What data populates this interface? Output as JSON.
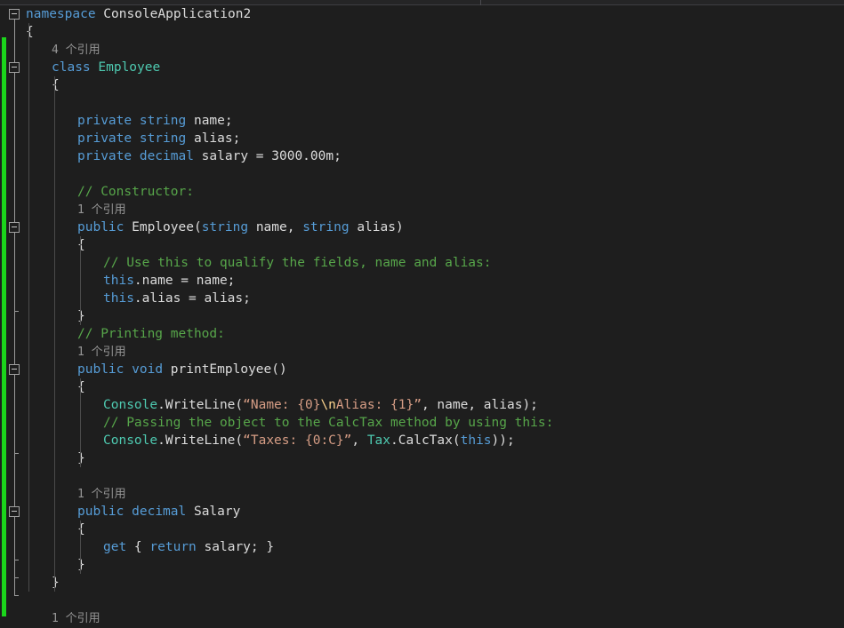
{
  "window": {
    "theme": "visual-studio-dark",
    "colors": {
      "background": "#1E1E1E",
      "chrome": "#252526",
      "keyword": "#569CD6",
      "type": "#4EC9B0",
      "string": "#D69D85",
      "comment": "#57A64A",
      "foreground": "#DCDCDC",
      "codelens": "#969696",
      "change_bar_saved": "#1BD51B",
      "indent_guide": "#4B4B4B",
      "fold_marker": "#A0A0A0"
    }
  },
  "editor": {
    "language": "csharp",
    "fold_markers": [
      {
        "name": "fold-namespace",
        "state": "expanded"
      },
      {
        "name": "fold-class-employee",
        "state": "expanded"
      },
      {
        "name": "fold-constructor-employee",
        "state": "expanded"
      },
      {
        "name": "fold-method-printemployee",
        "state": "expanded"
      },
      {
        "name": "fold-property-salary",
        "state": "expanded"
      }
    ],
    "codelens": {
      "class_employee": "4 个引用",
      "constructor_employee": "1 个引用",
      "method_printemployee": "1 个引用",
      "property_salary": "1 个引用",
      "next_member": "1 个引用"
    },
    "lines": [
      {
        "id": "l1",
        "indent": 0,
        "tokens": [
          {
            "t": "kw",
            "v": "namespace"
          },
          {
            "t": "txt",
            "v": " ConsoleApplication2"
          }
        ]
      },
      {
        "id": "l2",
        "indent": 0,
        "tokens": [
          {
            "t": "txt",
            "v": "{"
          }
        ]
      },
      {
        "id": "l3",
        "indent": 1,
        "tokens": [
          {
            "t": "lens",
            "v": "4 个引用"
          }
        ]
      },
      {
        "id": "l4",
        "indent": 1,
        "tokens": [
          {
            "t": "kw",
            "v": "class"
          },
          {
            "t": "txt",
            "v": " "
          },
          {
            "t": "typ",
            "v": "Employee"
          }
        ]
      },
      {
        "id": "l5",
        "indent": 1,
        "tokens": [
          {
            "t": "txt",
            "v": "{"
          }
        ]
      },
      {
        "id": "l6",
        "indent": 2,
        "tokens": []
      },
      {
        "id": "l7",
        "indent": 2,
        "tokens": [
          {
            "t": "kw",
            "v": "private"
          },
          {
            "t": "txt",
            "v": " "
          },
          {
            "t": "kw",
            "v": "string"
          },
          {
            "t": "txt",
            "v": " name;"
          }
        ]
      },
      {
        "id": "l8",
        "indent": 2,
        "tokens": [
          {
            "t": "kw",
            "v": "private"
          },
          {
            "t": "txt",
            "v": " "
          },
          {
            "t": "kw",
            "v": "string"
          },
          {
            "t": "txt",
            "v": " alias;"
          }
        ]
      },
      {
        "id": "l9",
        "indent": 2,
        "tokens": [
          {
            "t": "kw",
            "v": "private"
          },
          {
            "t": "txt",
            "v": " "
          },
          {
            "t": "kw",
            "v": "decimal"
          },
          {
            "t": "txt",
            "v": " salary = "
          },
          {
            "t": "num",
            "v": "3000.00m"
          },
          {
            "t": "txt",
            "v": ";"
          }
        ]
      },
      {
        "id": "l10",
        "indent": 2,
        "tokens": []
      },
      {
        "id": "l11",
        "indent": 2,
        "tokens": [
          {
            "t": "cmt",
            "v": "// Constructor:"
          }
        ]
      },
      {
        "id": "l12",
        "indent": 2,
        "tokens": [
          {
            "t": "lens",
            "v": "1 个引用"
          }
        ]
      },
      {
        "id": "l13",
        "indent": 2,
        "tokens": [
          {
            "t": "kw",
            "v": "public"
          },
          {
            "t": "txt",
            "v": " Employee("
          },
          {
            "t": "kw",
            "v": "string"
          },
          {
            "t": "txt",
            "v": " name, "
          },
          {
            "t": "kw",
            "v": "string"
          },
          {
            "t": "txt",
            "v": " alias)"
          }
        ]
      },
      {
        "id": "l14",
        "indent": 2,
        "tokens": [
          {
            "t": "txt",
            "v": "{"
          }
        ]
      },
      {
        "id": "l15",
        "indent": 3,
        "tokens": [
          {
            "t": "cmt",
            "v": "// Use this to qualify the fields, name and alias:"
          }
        ]
      },
      {
        "id": "l16",
        "indent": 3,
        "tokens": [
          {
            "t": "kw",
            "v": "this"
          },
          {
            "t": "txt",
            "v": ".name = name;"
          }
        ]
      },
      {
        "id": "l17",
        "indent": 3,
        "tokens": [
          {
            "t": "kw",
            "v": "this"
          },
          {
            "t": "txt",
            "v": ".alias = alias;"
          }
        ]
      },
      {
        "id": "l18",
        "indent": 2,
        "tokens": [
          {
            "t": "txt",
            "v": "}"
          }
        ]
      },
      {
        "id": "l19",
        "indent": 2,
        "tokens": [
          {
            "t": "cmt",
            "v": "// Printing method:"
          }
        ]
      },
      {
        "id": "l20",
        "indent": 2,
        "tokens": [
          {
            "t": "lens",
            "v": "1 个引用"
          }
        ]
      },
      {
        "id": "l21",
        "indent": 2,
        "tokens": [
          {
            "t": "kw",
            "v": "public"
          },
          {
            "t": "txt",
            "v": " "
          },
          {
            "t": "kw",
            "v": "void"
          },
          {
            "t": "txt",
            "v": " printEmployee()"
          }
        ]
      },
      {
        "id": "l22",
        "indent": 2,
        "tokens": [
          {
            "t": "txt",
            "v": "{"
          }
        ]
      },
      {
        "id": "l23",
        "indent": 3,
        "tokens": [
          {
            "t": "typ",
            "v": "Console"
          },
          {
            "t": "txt",
            "v": ".WriteLine("
          },
          {
            "t": "str",
            "v": "“Name: {0}"
          },
          {
            "t": "esc",
            "v": "\\n"
          },
          {
            "t": "str",
            "v": "Alias: {1}”"
          },
          {
            "t": "txt",
            "v": ", name, alias);"
          }
        ]
      },
      {
        "id": "l24",
        "indent": 3,
        "tokens": [
          {
            "t": "cmt",
            "v": "// Passing the object to the CalcTax method by using this:"
          }
        ]
      },
      {
        "id": "l25",
        "indent": 3,
        "tokens": [
          {
            "t": "typ",
            "v": "Console"
          },
          {
            "t": "txt",
            "v": ".WriteLine("
          },
          {
            "t": "str",
            "v": "“Taxes: {0:C}”"
          },
          {
            "t": "txt",
            "v": ", "
          },
          {
            "t": "typ",
            "v": "Tax"
          },
          {
            "t": "txt",
            "v": ".CalcTax("
          },
          {
            "t": "kw",
            "v": "this"
          },
          {
            "t": "txt",
            "v": "));"
          }
        ]
      },
      {
        "id": "l26",
        "indent": 2,
        "tokens": [
          {
            "t": "txt",
            "v": "}"
          }
        ]
      },
      {
        "id": "l27",
        "indent": 2,
        "tokens": []
      },
      {
        "id": "l28",
        "indent": 2,
        "tokens": [
          {
            "t": "lens",
            "v": "1 个引用"
          }
        ]
      },
      {
        "id": "l29",
        "indent": 2,
        "tokens": [
          {
            "t": "kw",
            "v": "public"
          },
          {
            "t": "txt",
            "v": " "
          },
          {
            "t": "kw",
            "v": "decimal"
          },
          {
            "t": "txt",
            "v": " Salary"
          }
        ]
      },
      {
        "id": "l30",
        "indent": 2,
        "tokens": [
          {
            "t": "txt",
            "v": "{"
          }
        ]
      },
      {
        "id": "l31",
        "indent": 3,
        "tokens": [
          {
            "t": "kw",
            "v": "get"
          },
          {
            "t": "txt",
            "v": " { "
          },
          {
            "t": "kw",
            "v": "return"
          },
          {
            "t": "txt",
            "v": " salary; }"
          }
        ]
      },
      {
        "id": "l32",
        "indent": 2,
        "tokens": [
          {
            "t": "txt",
            "v": "}"
          }
        ]
      },
      {
        "id": "l33",
        "indent": 1,
        "tokens": [
          {
            "t": "txt",
            "v": "}"
          }
        ]
      },
      {
        "id": "l34",
        "indent": 1,
        "tokens": []
      },
      {
        "id": "l35",
        "indent": 1,
        "tokens": [
          {
            "t": "lens",
            "v": "1 个引用"
          }
        ]
      }
    ]
  }
}
